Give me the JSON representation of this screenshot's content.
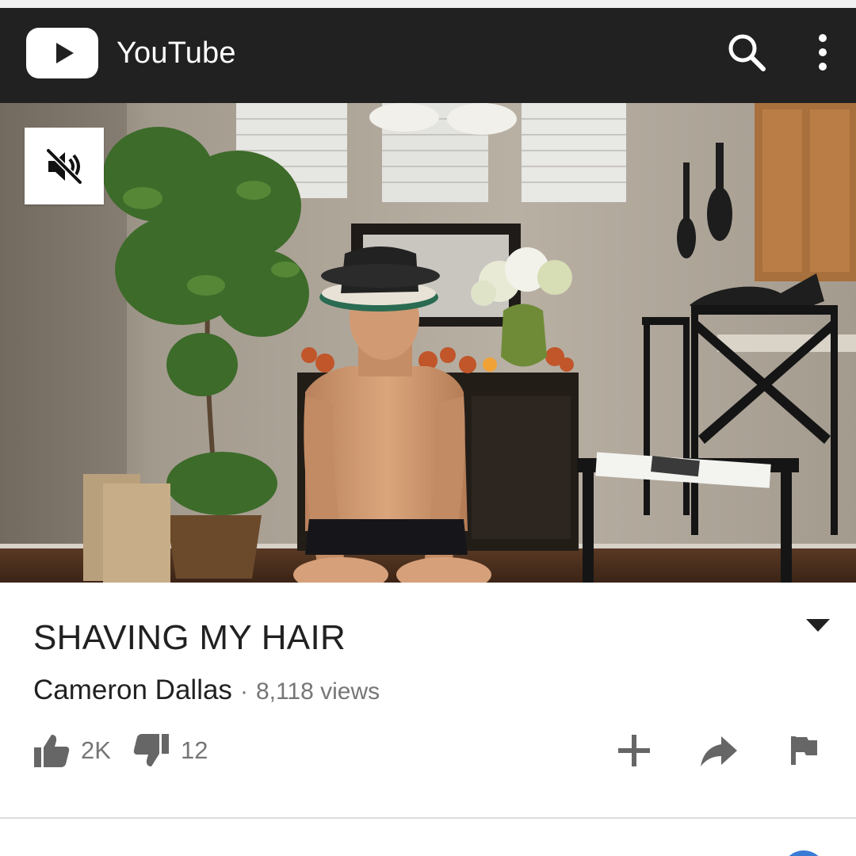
{
  "app_bar": {
    "title": "YouTube",
    "icons": {
      "logo": "youtube-play-logo",
      "search": "search-icon",
      "more": "more-vert-icon"
    },
    "background": "#212121"
  },
  "player": {
    "mute_icon": "volume-off-icon"
  },
  "video": {
    "title": "SHAVING MY HAIR",
    "channel": "Cameron Dallas",
    "separator": "·",
    "views": "8,118 views",
    "likes": "2K",
    "dislikes": "12"
  },
  "actions": {
    "icons": [
      "thumb-up-icon",
      "thumb-down-icon",
      "add-to-playlist-icon",
      "share-icon",
      "flag-icon"
    ]
  },
  "colors": {
    "text_primary": "#212121",
    "text_secondary": "#767676",
    "accent": "#3a7bd5"
  }
}
